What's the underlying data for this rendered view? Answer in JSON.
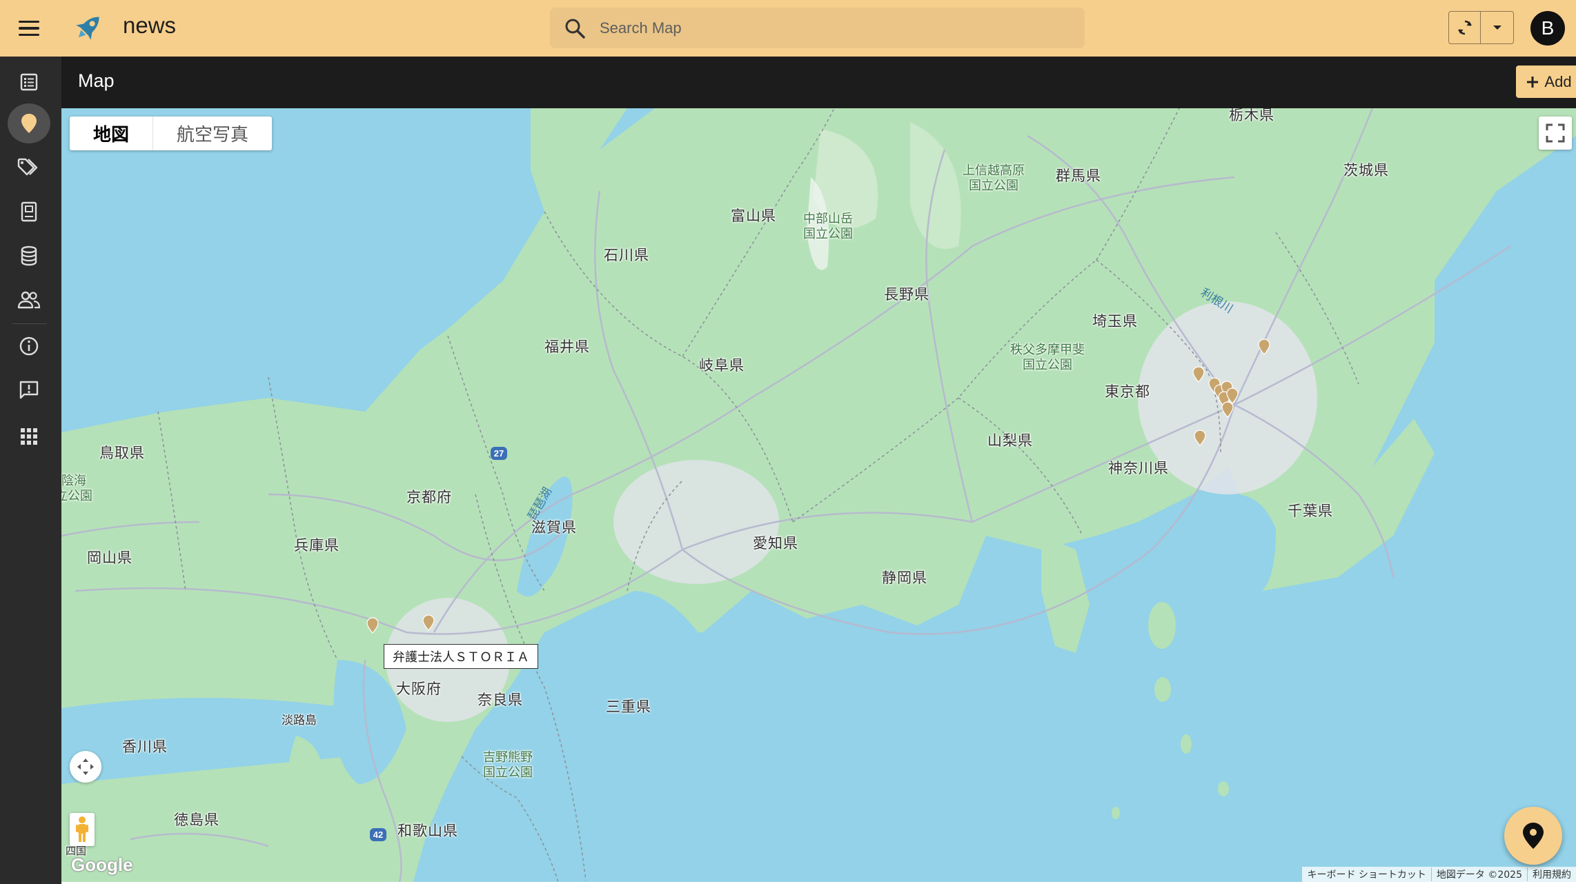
{
  "app": {
    "title": "news"
  },
  "search": {
    "placeholder": "Search Map"
  },
  "user": {
    "avatar_letter": "B"
  },
  "header": {
    "title": "Map",
    "add_label": "Add"
  },
  "map": {
    "type_controls": {
      "map": "地図",
      "satellite": "航空写真"
    },
    "tooltip": "弁護士法人ＳＴＯＲＩＡ",
    "attribution": [
      "キーボード ショートカット",
      "地図データ ©2025",
      "利用規約"
    ],
    "google_label": "Google",
    "route_shields": [
      "27",
      "42"
    ],
    "labels": {
      "tochigi": "栃木県",
      "ibaraki": "茨城県",
      "gunma": "群馬県",
      "joshinetsu_park": "上信越高原\n国立公園",
      "toyama": "富山県",
      "chubu_park": "中部山岳\n国立公園",
      "ishikawa": "石川県",
      "nagano": "長野県",
      "saitama": "埼玉県",
      "tone_river": "利根川",
      "fukui": "福井県",
      "chichibu_park": "秩父多摩甲斐\n国立公園",
      "gifu": "岐阜県",
      "tokyo": "東京都",
      "yamanashi": "山梨県",
      "kanagawa": "神奈川県",
      "tottori": "鳥取県",
      "sanin_park": "山陰海\n国立公園",
      "kyoto": "京都府",
      "biwa_lake": "琵琶湖",
      "shiga": "滋賀県",
      "aichi": "愛知県",
      "chiba": "千葉県",
      "okayama": "岡山県",
      "hyogo": "兵庫県",
      "shizuoka": "静岡県",
      "osaka": "大阪府",
      "nara": "奈良県",
      "mie": "三重県",
      "awaji": "淡路島",
      "kagawa": "香川県",
      "yoshino_park": "吉野熊野\n国立公園",
      "tokushima": "徳島県",
      "wakayama": "和歌山県",
      "shikoku": "四国"
    }
  },
  "colors": {
    "accent": "#f7cf8c",
    "header": "#1c1c1c",
    "rail": "#2b2b2b",
    "water": "#93d2e8",
    "land": "#b5e1b8",
    "marker": "#c9a56e"
  },
  "icons": {
    "rail": [
      "list-icon",
      "map-pin-icon",
      "tags-icon",
      "book-icon",
      "database-icon",
      "users-icon",
      "info-icon",
      "feedback-icon",
      "apps-icon"
    ]
  }
}
